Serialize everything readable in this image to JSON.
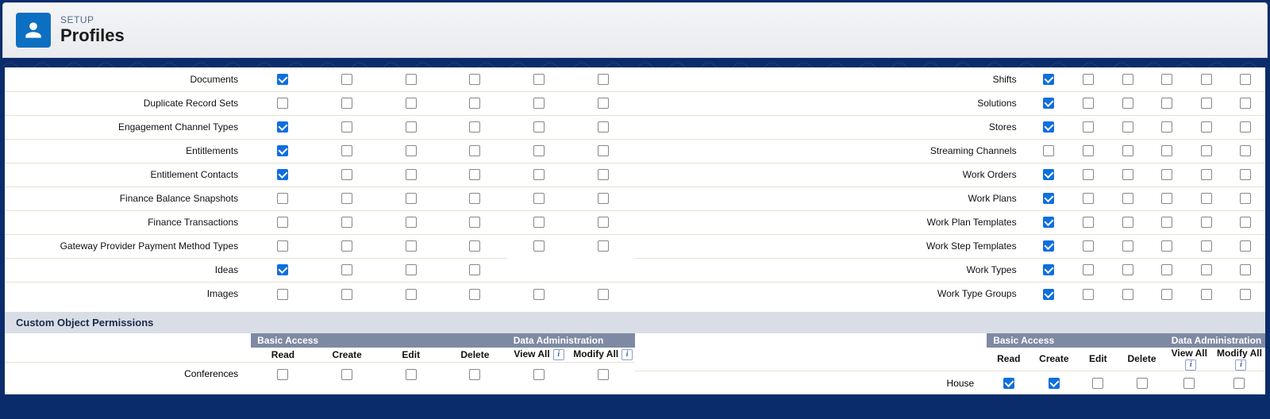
{
  "header": {
    "supertitle": "SETUP",
    "title": "Profiles"
  },
  "sections": {
    "custom_object_permissions": "Custom Object Permissions"
  },
  "column_groups": {
    "basic_access": "Basic Access",
    "data_administration": "Data Administration"
  },
  "custom_columns": {
    "read": "Read",
    "create": "Create",
    "edit": "Edit",
    "delete": "Delete",
    "view_all": "View All",
    "modify_all": "Modify All"
  },
  "info_glyph": "i",
  "left_rows": [
    {
      "label": "Documents",
      "checks": [
        true,
        false,
        false,
        false,
        false,
        false
      ],
      "full": true
    },
    {
      "label": "Duplicate Record Sets",
      "checks": [
        false,
        false,
        false,
        false,
        false,
        false
      ],
      "full": true
    },
    {
      "label": "Engagement Channel Types",
      "checks": [
        true,
        false,
        false,
        false,
        false,
        false
      ],
      "full": true
    },
    {
      "label": "Entitlements",
      "checks": [
        true,
        false,
        false,
        false,
        false,
        false
      ],
      "full": true
    },
    {
      "label": "Entitlement Contacts",
      "checks": [
        true,
        false,
        false,
        false,
        false,
        false
      ],
      "full": true
    },
    {
      "label": "Finance Balance Snapshots",
      "checks": [
        false,
        false,
        false,
        false,
        false,
        false
      ],
      "full": true
    },
    {
      "label": "Finance Transactions",
      "checks": [
        false,
        false,
        false,
        false,
        false,
        false
      ],
      "full": true
    },
    {
      "label": "Gateway Provider Payment Method Types",
      "checks": [
        false,
        false,
        false,
        false,
        false,
        false
      ],
      "full": true
    },
    {
      "label": "Ideas",
      "checks": [
        true,
        false,
        false,
        false,
        false,
        false
      ],
      "full": false
    },
    {
      "label": "Images",
      "checks": [
        false,
        false,
        false,
        false,
        false,
        false
      ],
      "full": true
    }
  ],
  "right_rows": [
    {
      "label": "Shifts",
      "checks": [
        true,
        false,
        false,
        false,
        false,
        false
      ],
      "full": true
    },
    {
      "label": "Solutions",
      "checks": [
        true,
        false,
        false,
        false,
        false,
        false
      ],
      "full": true
    },
    {
      "label": "Stores",
      "checks": [
        true,
        false,
        false,
        false,
        false,
        false
      ],
      "full": true
    },
    {
      "label": "Streaming Channels",
      "checks": [
        false,
        false,
        false,
        false,
        false,
        false
      ],
      "full": true
    },
    {
      "label": "Work Orders",
      "checks": [
        true,
        false,
        false,
        false,
        false,
        false
      ],
      "full": true
    },
    {
      "label": "Work Plans",
      "checks": [
        true,
        false,
        false,
        false,
        false,
        false
      ],
      "full": true
    },
    {
      "label": "Work Plan Templates",
      "checks": [
        true,
        false,
        false,
        false,
        false,
        false
      ],
      "full": true
    },
    {
      "label": "Work Step Templates",
      "checks": [
        true,
        false,
        false,
        false,
        false,
        false
      ],
      "full": true
    },
    {
      "label": "Work Types",
      "checks": [
        true,
        false,
        false,
        false,
        false,
        false
      ],
      "full": true
    },
    {
      "label": "Work Type Groups",
      "checks": [
        true,
        false,
        false,
        false,
        false,
        false
      ],
      "full": true
    }
  ],
  "custom_left": [
    {
      "label": "Conferences",
      "checks": [
        false,
        false,
        false,
        false,
        false,
        false
      ]
    }
  ],
  "custom_right": [
    {
      "label": "House",
      "checks": [
        true,
        true,
        false,
        false,
        false,
        false
      ]
    }
  ]
}
